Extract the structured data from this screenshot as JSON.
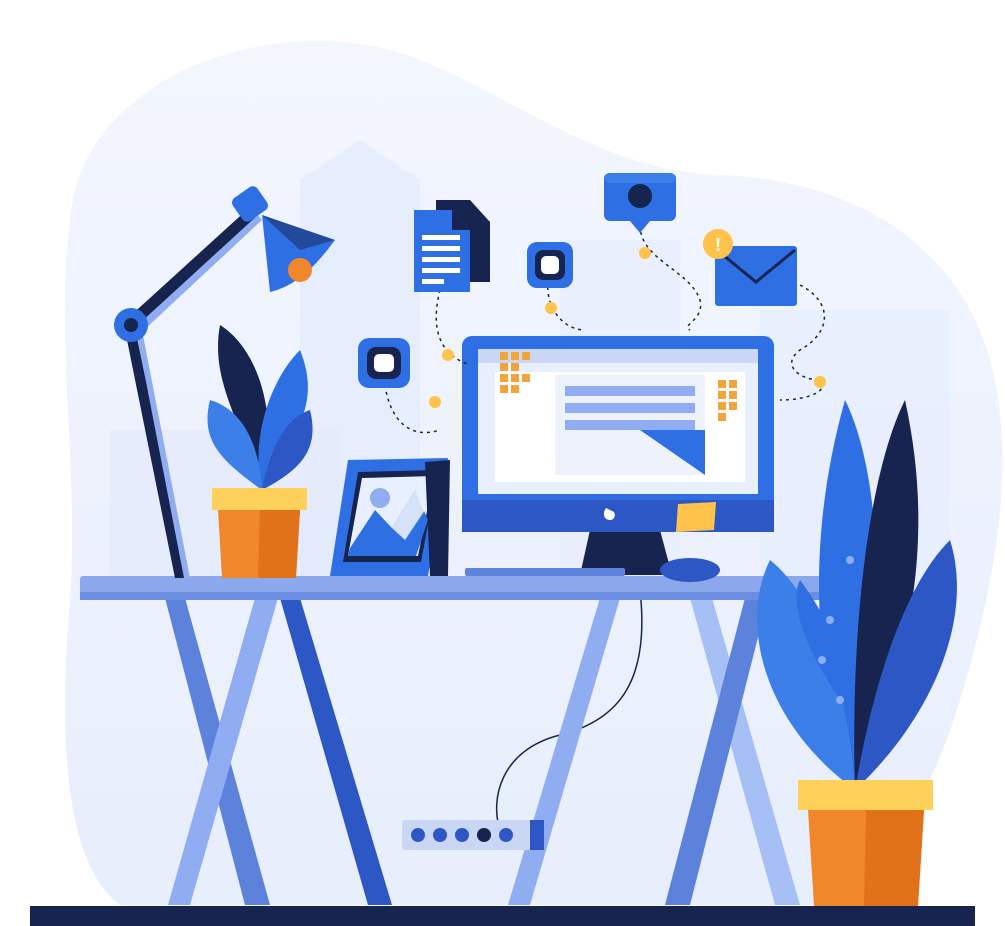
{
  "scene": {
    "subject": "office-desk-workspace-illustration",
    "colors": {
      "blob": "#eef3fd",
      "blob_shadow": "#e2eafa",
      "primary_blue": "#2f6fe4",
      "dark_navy": "#17244f",
      "mid_blue": "#3d7fe8",
      "light_blue": "#8fb0ef",
      "desk_top": "#7a9fe0",
      "orange": "#f0872a",
      "yellow": "#ffd05a",
      "screen_bg": "#e8efff",
      "white": "#ffffff"
    },
    "elements": [
      "desk-lamp-icon",
      "potted-plant-small-icon",
      "photo-frame-icon",
      "computer-monitor-icon",
      "keyboard-icon",
      "mouse-icon",
      "potted-plant-large-icon",
      "power-strip-icon",
      "document-icon",
      "chat-bubble-icon",
      "email-envelope-icon",
      "notification-badge-icon"
    ],
    "power_strip_sockets": 5,
    "notification_badge_symbol": "!"
  }
}
